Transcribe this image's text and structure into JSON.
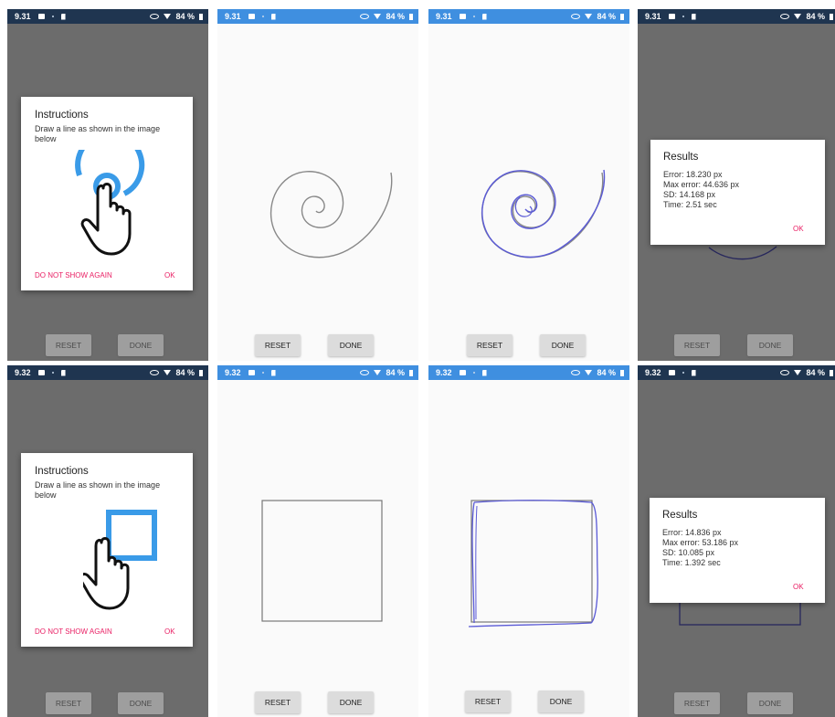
{
  "status": {
    "top_time": "9.31",
    "bottom_time": "9.32",
    "battery": "84 %"
  },
  "controls": {
    "reset_label": "RESET",
    "done_label": "DONE"
  },
  "instructions": {
    "title": "Instructions",
    "text": "Draw a line as shown in the image below",
    "dont_show": "DO NOT SHOW AGAIN",
    "ok": "OK"
  },
  "results_spiral": {
    "title": "Results",
    "error": "Error: 18.230 px",
    "max_error": "Max error: 44.636 px",
    "sd": "SD: 14.168 px",
    "time": "Time: 2.51 sec",
    "ok": "OK"
  },
  "results_square": {
    "title": "Results",
    "error": "Error: 14.836 px",
    "max_error": "Max error: 53.186 px",
    "sd": "SD: 10.085 px",
    "time": "Time: 1.392 sec",
    "ok": "OK"
  },
  "colors": {
    "status_active": "#3f8fe0",
    "status_dimmed": "#1f3550",
    "accent": "#e91e63",
    "guide_icon": "#3a9be8",
    "user_trace": "#5a5ad6"
  },
  "icons": [
    "image-icon",
    "sd-card-icon",
    "eye-icon",
    "wifi-icon",
    "battery-icon",
    "touch-hand-icon"
  ]
}
